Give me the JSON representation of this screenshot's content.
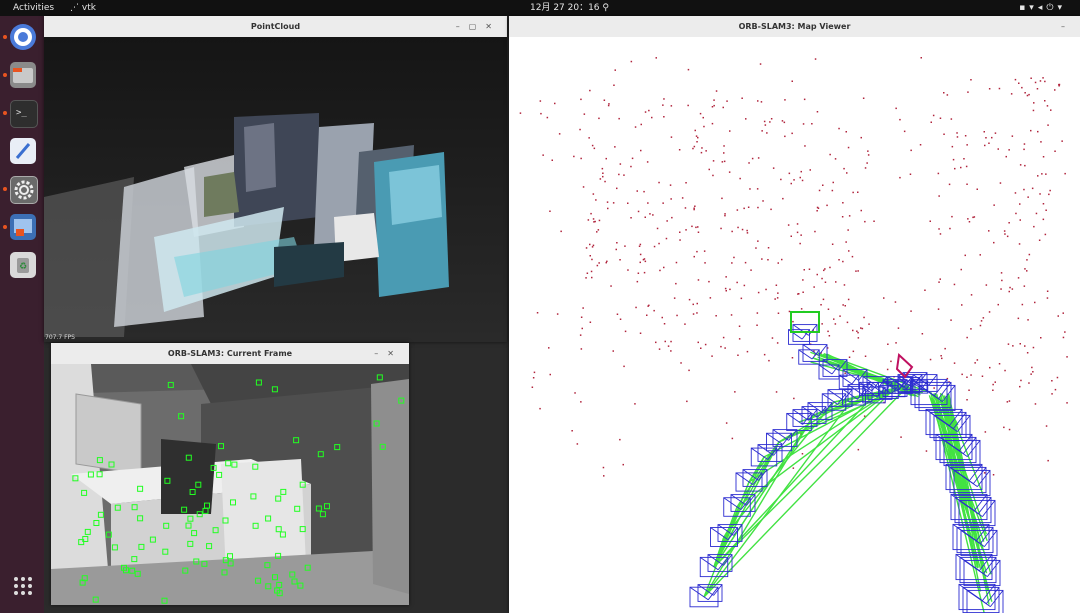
{
  "topbar": {
    "activities": "Activities",
    "app_name": "vtk",
    "clock": "12月 27  20：16",
    "tray_icons": [
      "network-icon",
      "wifi-icon",
      "volume-icon",
      "power-icon"
    ]
  },
  "dock": {
    "items": [
      {
        "name": "chromium",
        "icon": "browser-icon",
        "color": "#4a7ad9",
        "running": true
      },
      {
        "name": "files",
        "icon": "folder-icon",
        "color": "#8a8a8a",
        "running": true
      },
      {
        "name": "terminal",
        "icon": "terminal-icon",
        "color": "#2e2e2e",
        "running": true
      },
      {
        "name": "text-editor",
        "icon": "pencil-icon",
        "color": "#e9eef6",
        "running": false
      },
      {
        "name": "settings",
        "icon": "gear-icon",
        "color": "#8c8c8c",
        "running": true
      },
      {
        "name": "software",
        "icon": "app-store-icon",
        "color": "#3c6fb5",
        "running": true
      },
      {
        "name": "trash",
        "icon": "trash-icon",
        "color": "#d9d9d9",
        "running": false
      }
    ],
    "app_grid_icon": "grid-icon"
  },
  "windows": {
    "pointcloud": {
      "title": "PointCloud",
      "fps": "707.7 FPS"
    },
    "current_frame": {
      "title": "ORB-SLAM3: Current Frame"
    },
    "map_viewer": {
      "title": "ORB-SLAM3: Map Viewer"
    }
  },
  "colors": {
    "map_points": "#b0243c",
    "keyframes": "#2b2bd0",
    "covisibility": "#22dd22",
    "current_camera": "#22cc22",
    "features": "#22ff22"
  }
}
